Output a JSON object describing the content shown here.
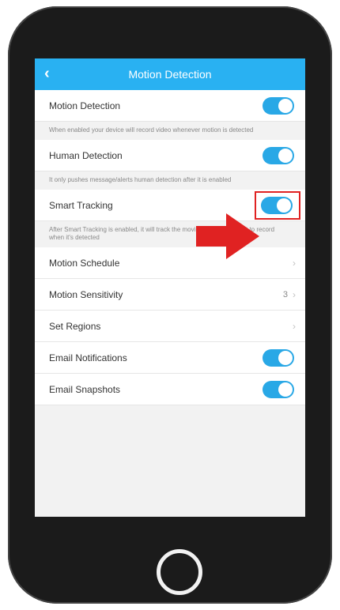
{
  "nav": {
    "back_icon": "chevron-left-icon",
    "title": "Motion Detection"
  },
  "settings": {
    "motion_detection": {
      "label": "Motion Detection",
      "enabled": true,
      "note": "When enabled your device will record video whenever motion is detected"
    },
    "human_detection": {
      "label": "Human Detection",
      "enabled": true,
      "note": "It only pushes message/alerts human detection after it is enabled"
    },
    "smart_tracking": {
      "label": "Smart Tracking",
      "enabled": true,
      "note": "After Smart Tracking is enabled, it will track the moving object and start to record when it's detected"
    },
    "motion_schedule": {
      "label": "Motion Schedule",
      "chevron": "›"
    },
    "motion_sensitivity": {
      "label": "Motion Sensitivity",
      "value": "3",
      "chevron": "›"
    },
    "set_regions": {
      "label": "Set Regions",
      "chevron": "›"
    },
    "email_notifications": {
      "label": "Email Notifications",
      "enabled": true
    },
    "email_snapshots": {
      "label": "Email Snapshots",
      "enabled": true
    }
  },
  "colors": {
    "accent": "#29b1f2",
    "toggle_on": "#29a8e6",
    "annotation_red": "#e02222"
  }
}
